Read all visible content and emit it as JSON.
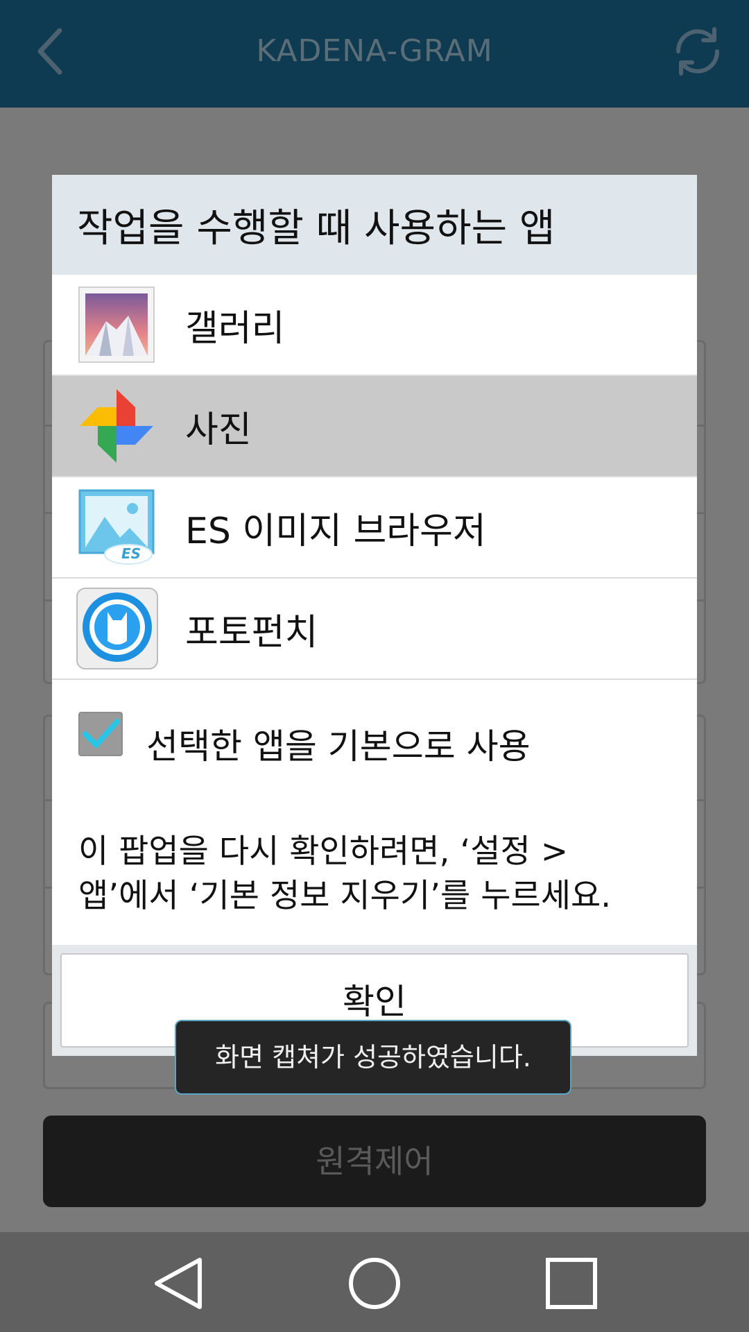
{
  "app_bar": {
    "title": "KADENA-GRAM",
    "back_icon": "chevron-left-icon",
    "refresh_icon": "refresh-icon"
  },
  "dialog": {
    "title": "작업을 수행할 때 사용하는 앱",
    "apps": [
      {
        "label": "갤러리",
        "icon": "gallery-icon",
        "selected": false
      },
      {
        "label": "사진",
        "icon": "photos-pinwheel-icon",
        "selected": true
      },
      {
        "label": "ES 이미지 브라우저",
        "icon": "es-image-browser-icon",
        "selected": false
      },
      {
        "label": "포토펀치",
        "icon": "photopunch-icon",
        "selected": false
      }
    ],
    "default_checkbox": {
      "label": "선택한 앱을 기본으로 사용",
      "checked": true
    },
    "info_line1": "이 팝업을 다시 확인하려면, ‘설정 >",
    "info_line2": "앱’에서 ‘기본 정보 지우기’를 누르세요.",
    "ok_label": "확인"
  },
  "toast": {
    "text": "화면 캡쳐가 성공하였습니다."
  },
  "background": {
    "remote_button_label": "원격제어"
  },
  "colors": {
    "app_bar": "#0e3a52",
    "dialog_header": "#dfe6ec",
    "selected_row": "#c9c9c9",
    "check_accent": "#29c5e6",
    "toast_border": "#5aa6c4"
  },
  "navigation": {
    "back": "nav-back-icon",
    "home": "nav-home-icon",
    "recents": "nav-recents-icon"
  }
}
